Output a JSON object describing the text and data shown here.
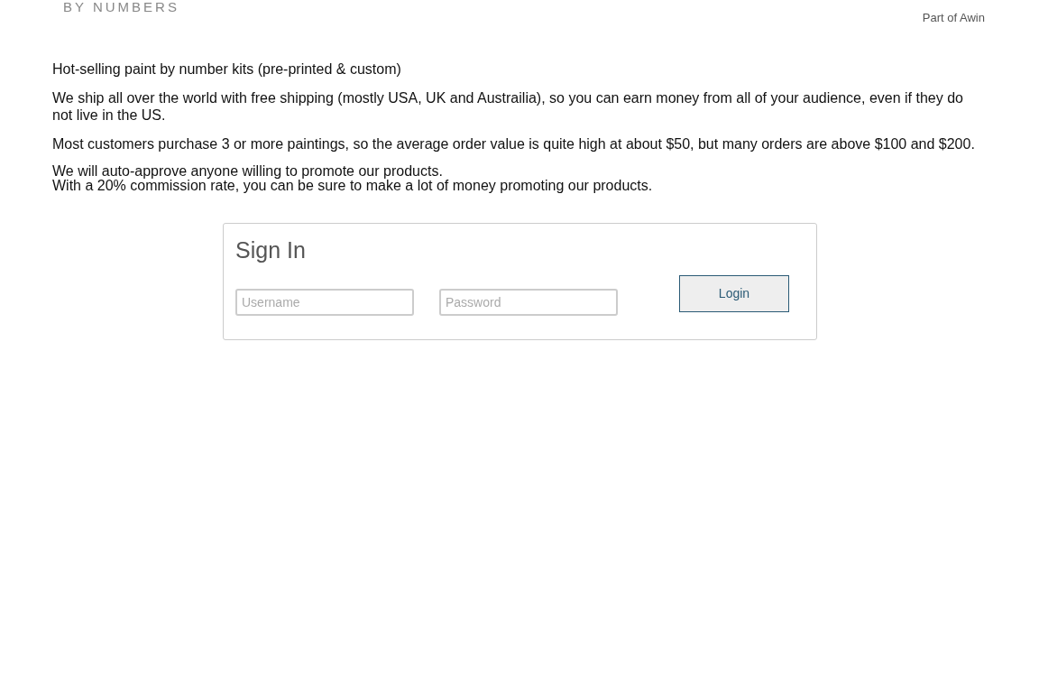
{
  "header": {
    "brand_tagline": "BY NUMBERS",
    "partner_note": "Part of Awin"
  },
  "paragraphs": [
    [
      "Hot-selling paint by number kits (pre-printed & custom)"
    ],
    [
      "We ship all over the world with free shipping (mostly USA, UK and Austrailia), so you can earn money from all of your audience, even if they do not live in the US."
    ],
    [
      "Most customers purchase 3 or more paintings, so the average order value is quite high at about $50, but many orders are above $100 and $200."
    ],
    [
      "We will auto-approve anyone willing to promote our products.",
      "With a 20% commission rate, you can be sure to make a lot of money promoting our products."
    ]
  ],
  "sign_in": {
    "title": "Sign In",
    "username": {
      "placeholder": "Username"
    },
    "password": {
      "placeholder": "Password"
    },
    "button": "Login"
  }
}
